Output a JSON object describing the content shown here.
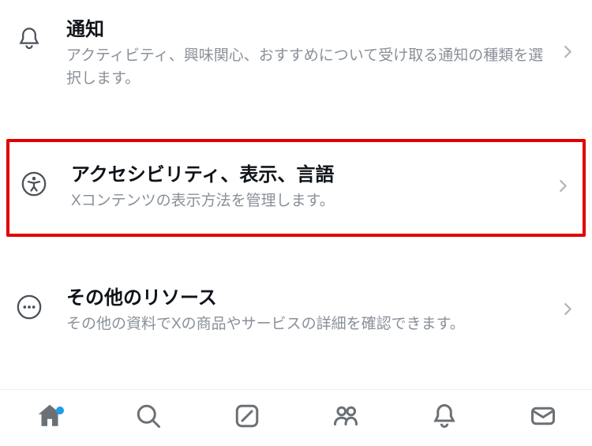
{
  "settings": {
    "items": [
      {
        "id": "notifications",
        "title": "通知",
        "description": "アクティビティ、興味関心、おすすめについて受け取る通知の種類を選択します。",
        "icon": "bell-icon",
        "highlighted": false
      },
      {
        "id": "accessibility-display-language",
        "title": "アクセシビリティ、表示、言語",
        "description": "Xコンテンツの表示方法を管理します。",
        "icon": "accessibility-icon",
        "highlighted": true
      },
      {
        "id": "other-resources",
        "title": "その他のリソース",
        "description": "その他の資料でXの商品やサービスの詳細を確認できます。",
        "icon": "more-circle-icon",
        "highlighted": false
      }
    ]
  },
  "bottom_nav": {
    "items": [
      {
        "id": "home",
        "icon": "home-icon",
        "active": true,
        "has_dot": true
      },
      {
        "id": "search",
        "icon": "search-icon",
        "active": false,
        "has_dot": false
      },
      {
        "id": "compose",
        "icon": "compose-icon",
        "active": false,
        "has_dot": false
      },
      {
        "id": "communities",
        "icon": "people-icon",
        "active": false,
        "has_dot": false
      },
      {
        "id": "notifications-tab",
        "icon": "bell-icon",
        "active": false,
        "has_dot": false
      },
      {
        "id": "messages",
        "icon": "envelope-icon",
        "active": false,
        "has_dot": false
      }
    ]
  },
  "colors": {
    "highlight_border": "#e20000",
    "accent": "#1d9bf0",
    "text": "#0f1419",
    "muted": "#8a9099"
  }
}
